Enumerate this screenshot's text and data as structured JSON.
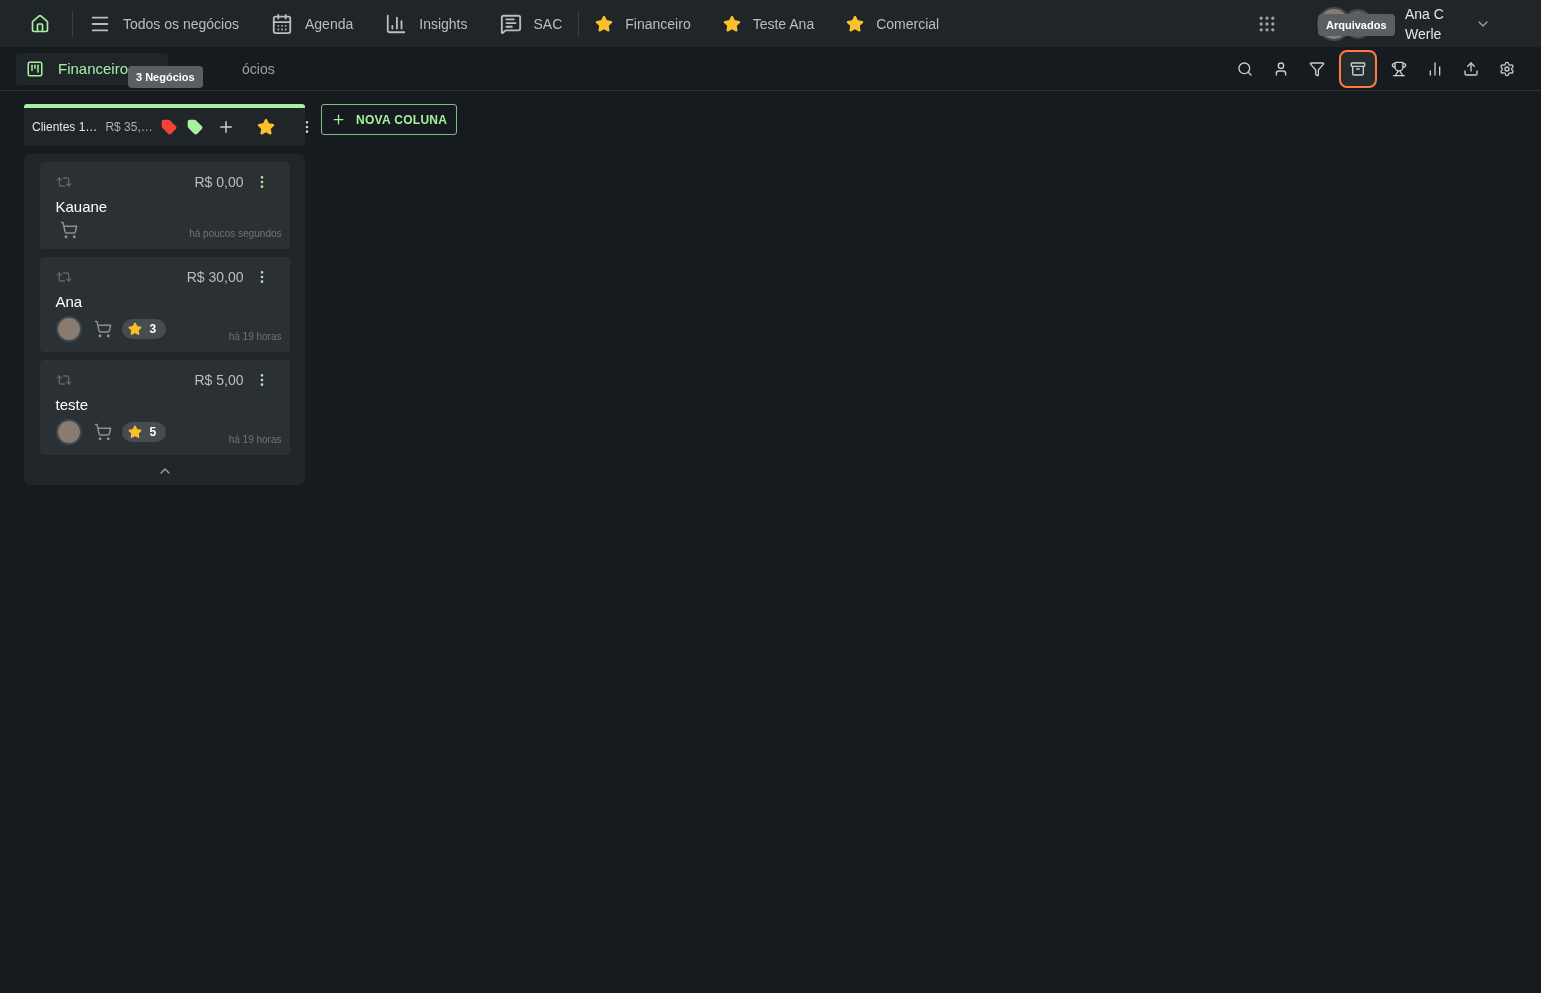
{
  "nav": {
    "items": [
      {
        "kind": "menu",
        "label": "Todos os negócios"
      },
      {
        "kind": "calendar",
        "label": "Agenda"
      },
      {
        "kind": "chart",
        "label": "Insights"
      },
      {
        "kind": "chat",
        "label": "SAC"
      },
      {
        "kind": "favorite",
        "label": "Financeiro"
      },
      {
        "kind": "favorite",
        "label": "Teste Ana"
      },
      {
        "kind": "favorite",
        "label": "Comercial"
      }
    ],
    "user": {
      "first_line": "Ana C",
      "second_line": "Werle"
    }
  },
  "board": {
    "title": "Financeiro",
    "count_fragment": "ócios",
    "count_tooltip": "3 Negócios",
    "archive_tooltip": "Arquivados",
    "tools": [
      {
        "kind": "search",
        "selected": false
      },
      {
        "kind": "person",
        "selected": false
      },
      {
        "kind": "filter",
        "selected": false
      },
      {
        "kind": "archive",
        "selected": true
      },
      {
        "kind": "trophy",
        "selected": false
      },
      {
        "kind": "chart",
        "selected": false
      },
      {
        "kind": "upload",
        "selected": false
      },
      {
        "kind": "settings",
        "selected": false
      }
    ]
  },
  "columns": [
    {
      "title": "Clientes 1…",
      "total": "R$ 35,…",
      "color": "#a6f0a0",
      "deals": [
        {
          "value": "R$ 0,00",
          "name": "Kauane",
          "avatar": false,
          "time": "há poucos segundos"
        },
        {
          "value": "R$ 30,00",
          "name": "Ana",
          "avatar": true,
          "stars": "3",
          "time": "há 19 horas"
        },
        {
          "value": "R$ 5,00",
          "name": "teste",
          "avatar": true,
          "stars": "5",
          "time": "há 19 horas"
        }
      ]
    }
  ],
  "new_column_button": "NOVA COLUNA"
}
